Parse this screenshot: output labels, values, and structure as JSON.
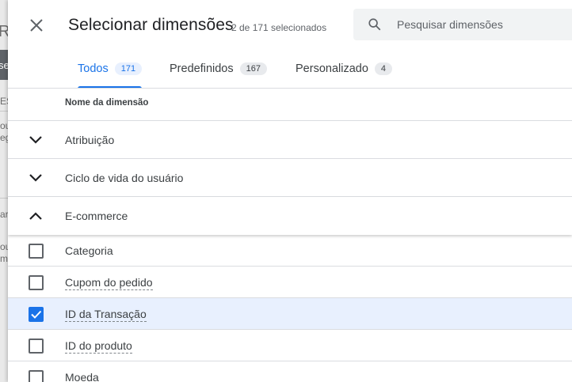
{
  "background": {
    "fragments": [
      "R",
      "se",
      "ES",
      "ou",
      "eg",
      "ar",
      "ou",
      "m"
    ]
  },
  "dialog": {
    "title": "Selecionar dimensões",
    "selection_count": "2 de 171 selecionados",
    "search": {
      "placeholder": "Pesquisar dimensões"
    },
    "tabs": [
      {
        "label": "Todos",
        "count": "171",
        "active": true
      },
      {
        "label": "Predefinidos",
        "count": "167",
        "active": false
      },
      {
        "label": "Personalizado",
        "count": "4",
        "active": false
      }
    ],
    "column_header": "Nome da dimensão",
    "groups": [
      {
        "label": "Atribuição",
        "expanded": false
      },
      {
        "label": "Ciclo de vida do usuário",
        "expanded": false
      },
      {
        "label": "E-commerce",
        "expanded": true
      }
    ],
    "items": [
      {
        "label": "Categoria",
        "checked": false,
        "dashed_underline": false
      },
      {
        "label": "Cupom do pedido",
        "checked": false,
        "dashed_underline": true
      },
      {
        "label": "ID da Transação",
        "checked": true,
        "dashed_underline": true
      },
      {
        "label": "ID do produto",
        "checked": false,
        "dashed_underline": true
      },
      {
        "label": "Moeda",
        "checked": false,
        "dashed_underline": false
      }
    ],
    "colors": {
      "accent": "#1a73e8",
      "selected_row": "#e8f0fe",
      "divider": "#dadce0"
    }
  }
}
